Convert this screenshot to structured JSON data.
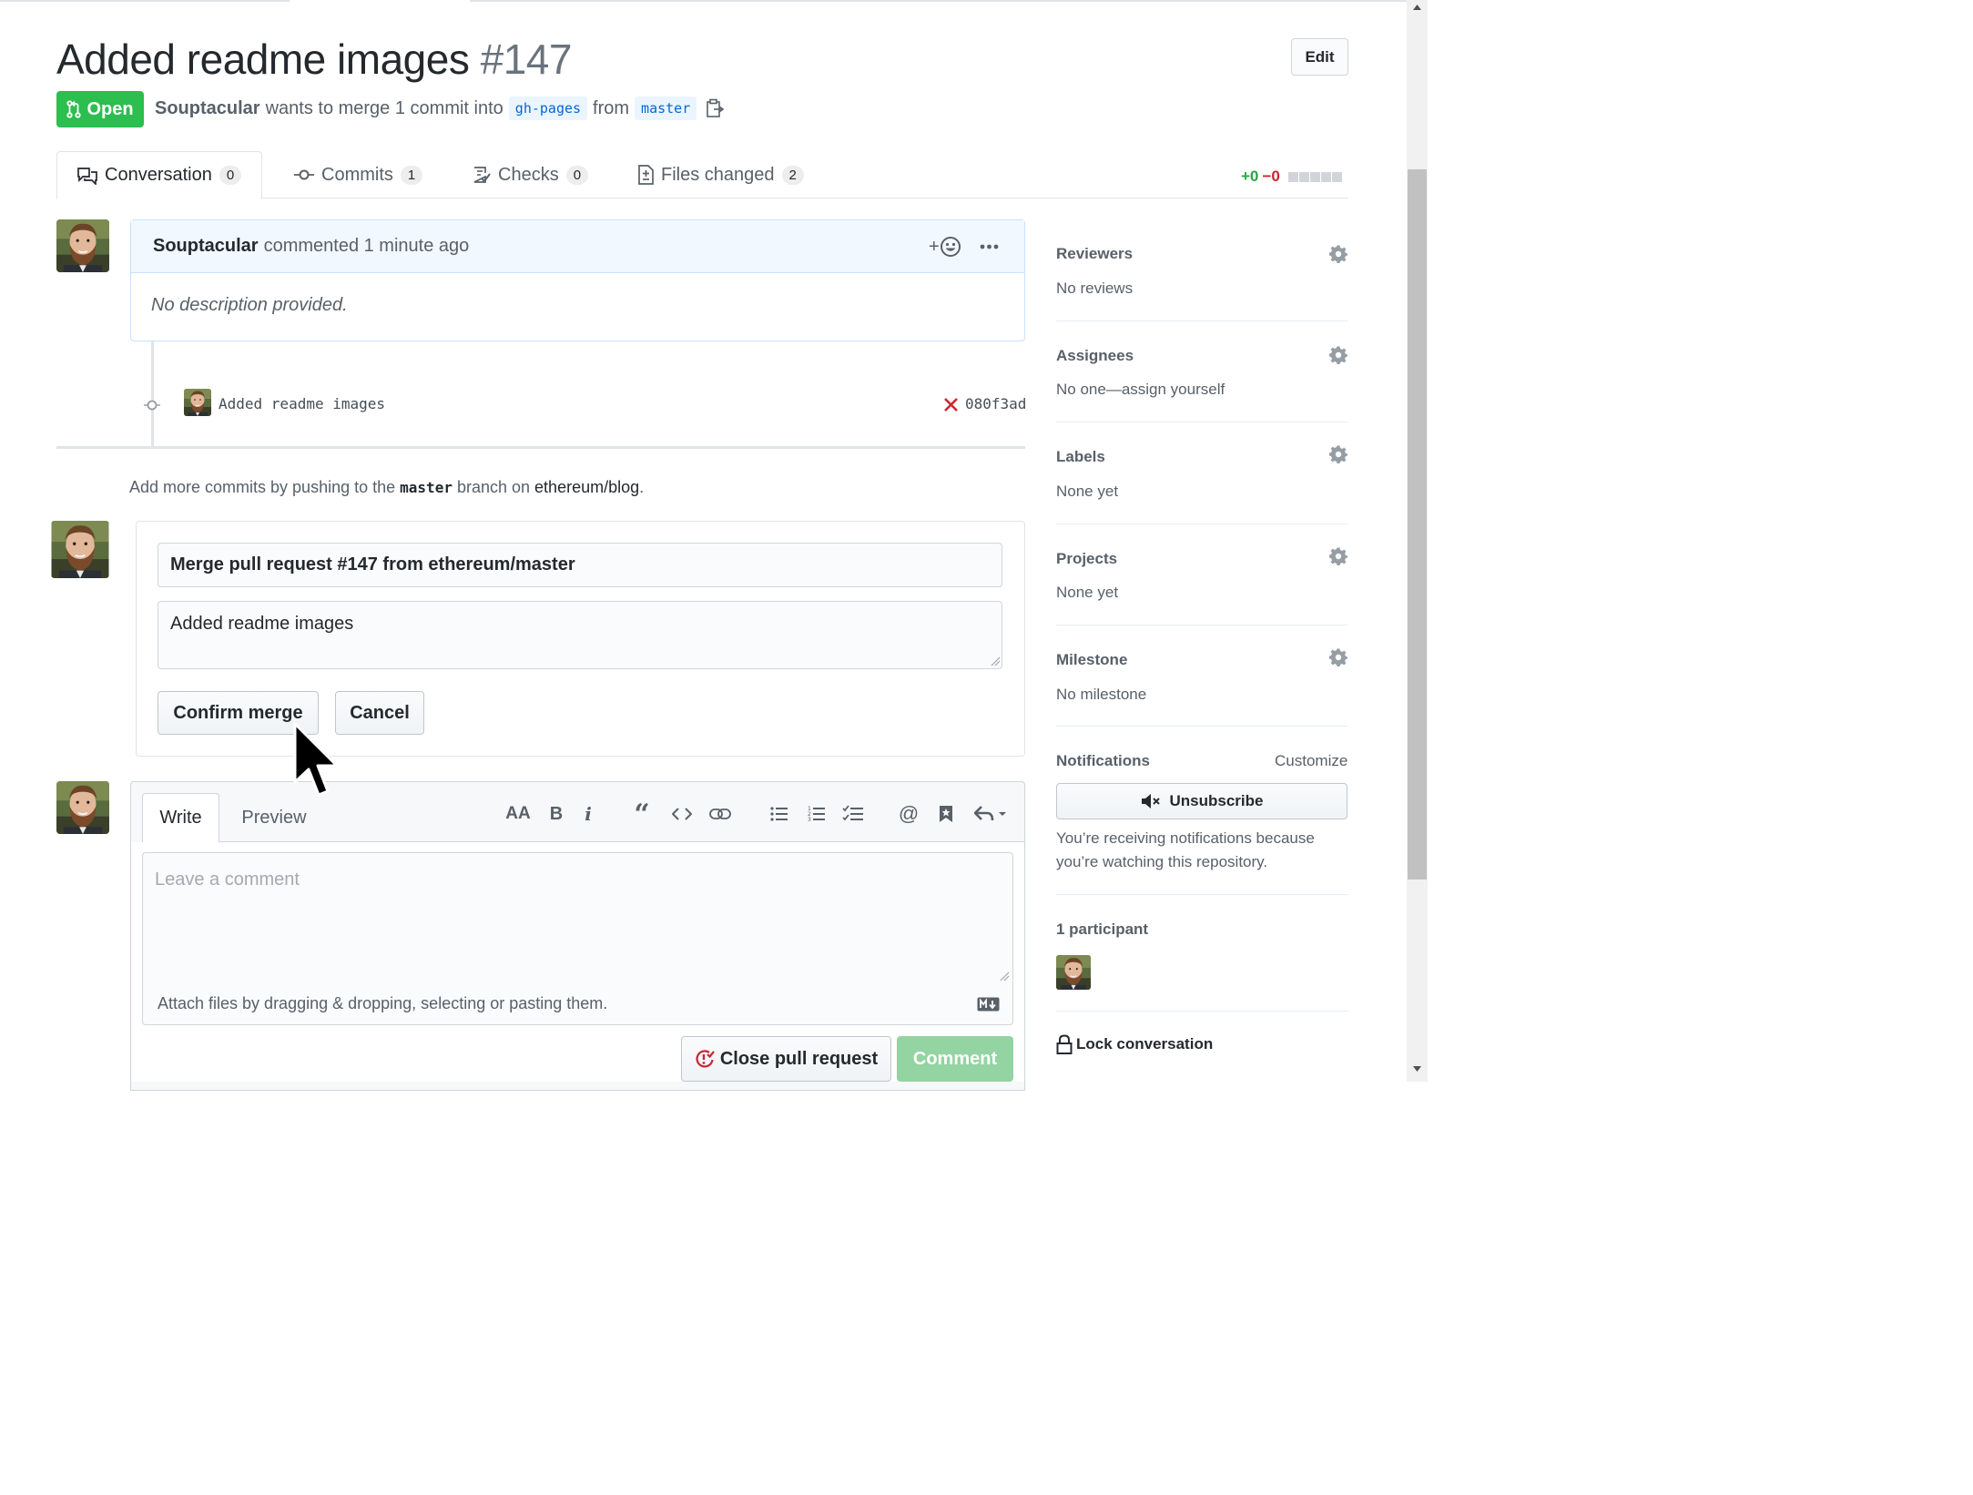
{
  "pr": {
    "title": "Added readme images",
    "number": "#147",
    "edit_label": "Edit",
    "state": "Open",
    "author": "Souptacular",
    "merge_text": "wants to merge 1 commit into",
    "base_branch": "gh-pages",
    "from_text": "from",
    "head_branch": "master"
  },
  "tabs": [
    {
      "label": "Conversation",
      "count": "0",
      "icon": "comment-discussion-icon"
    },
    {
      "label": "Commits",
      "count": "1",
      "icon": "git-commit-icon"
    },
    {
      "label": "Checks",
      "count": "0",
      "icon": "checklist-icon"
    },
    {
      "label": "Files changed",
      "count": "2",
      "icon": "file-diff-icon"
    }
  ],
  "diffstat": {
    "additions": "+0",
    "deletions": "−0"
  },
  "comment": {
    "author": "Souptacular",
    "meta": "commented 1 minute ago",
    "body": "No description provided."
  },
  "commit": {
    "message": "Added readme images",
    "sha": "080f3ad",
    "status": "failure"
  },
  "push_hint": {
    "prefix": "Add more commits by pushing to the",
    "branch": "master",
    "middle": "branch on",
    "repo": "ethereum/blog",
    "suffix": "."
  },
  "merge_form": {
    "title_value": "Merge pull request #147 from ethereum/master",
    "body_value": "Added readme images",
    "confirm_label": "Confirm merge",
    "cancel_label": "Cancel"
  },
  "editor": {
    "write_tab": "Write",
    "preview_tab": "Preview",
    "placeholder": "Leave a comment",
    "attach_text": "Attach files by dragging & dropping, selecting or pasting them.",
    "close_pr_label": "Close pull request",
    "comment_label": "Comment",
    "toolbar": [
      "header-icon",
      "bold-icon",
      "italic-icon",
      "quote-icon",
      "code-icon",
      "link-icon",
      "unordered-list-icon",
      "ordered-list-icon",
      "task-list-icon",
      "mention-icon",
      "saved-reply-icon",
      "reply-icon"
    ]
  },
  "sidebar": {
    "reviewers": {
      "label": "Reviewers",
      "value": "No reviews"
    },
    "assignees": {
      "label": "Assignees",
      "value": "No one—assign yourself"
    },
    "labels": {
      "label": "Labels",
      "value": "None yet"
    },
    "projects": {
      "label": "Projects",
      "value": "None yet"
    },
    "milestone": {
      "label": "Milestone",
      "value": "No milestone"
    },
    "notifications": {
      "label": "Notifications",
      "customize": "Customize",
      "unsubscribe": "Unsubscribe",
      "reason": "You’re receiving notifications because you’re watching this repository."
    },
    "participants_label": "1 participant",
    "lock_label": "Lock conversation"
  },
  "colors": {
    "open_green": "#2cbe4e",
    "link_blue": "#0366d6",
    "failure_red": "#cb2431",
    "comment_header_blue": "#f1f8ff"
  }
}
